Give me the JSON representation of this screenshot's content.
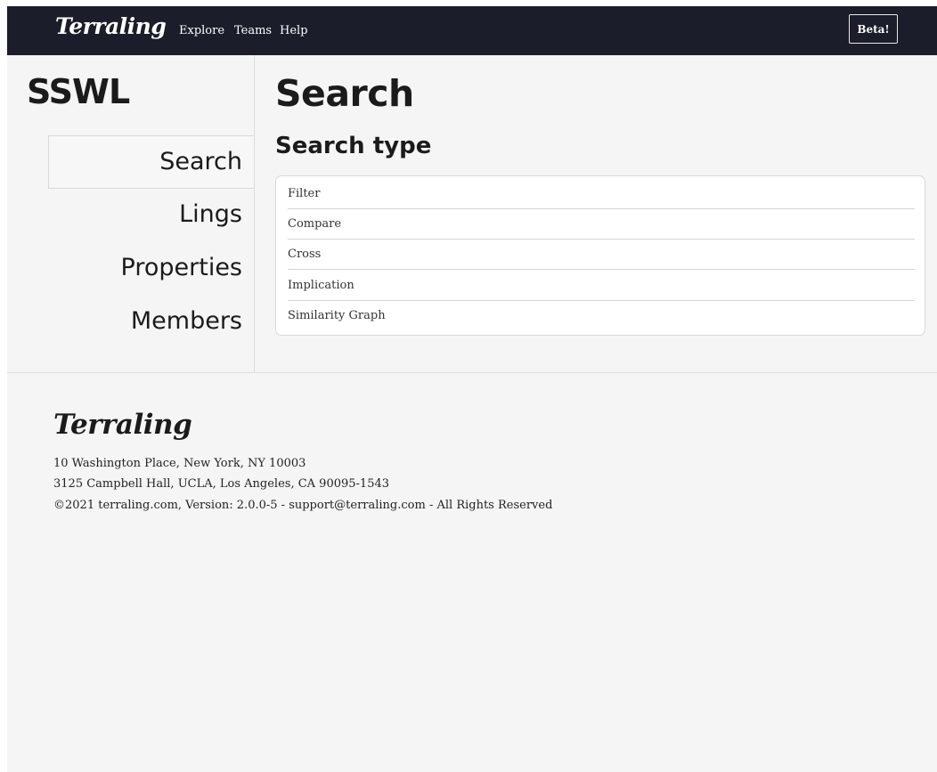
{
  "navbar": {
    "brand": "Terraling",
    "links": [
      "Explore",
      "Teams",
      "Help"
    ],
    "beta_label": "Beta!"
  },
  "sidebar": {
    "title": "SSWL",
    "items": [
      {
        "label": "Search",
        "active": true
      },
      {
        "label": "Lings",
        "active": false
      },
      {
        "label": "Properties",
        "active": false
      },
      {
        "label": "Members",
        "active": false
      }
    ]
  },
  "main": {
    "title": "Search",
    "section_title": "Search type",
    "search_types": [
      "Filter",
      "Compare",
      "Cross",
      "Implication",
      "Similarity Graph"
    ]
  },
  "footer": {
    "brand": "Terraling",
    "address_1": "10 Washington Place, New York, NY 10003",
    "address_2": "3125 Campbell Hall, UCLA, Los Angeles, CA 90095-1543",
    "copyright": "©2021 terraling.com, Version: 2.0.0-5 - support@terraling.com - All Rights Reserved"
  },
  "colors": {
    "navbar_bg": "#1b1d2a",
    "page_bg": "#f5f5f5",
    "text": "#1b1b1b"
  }
}
